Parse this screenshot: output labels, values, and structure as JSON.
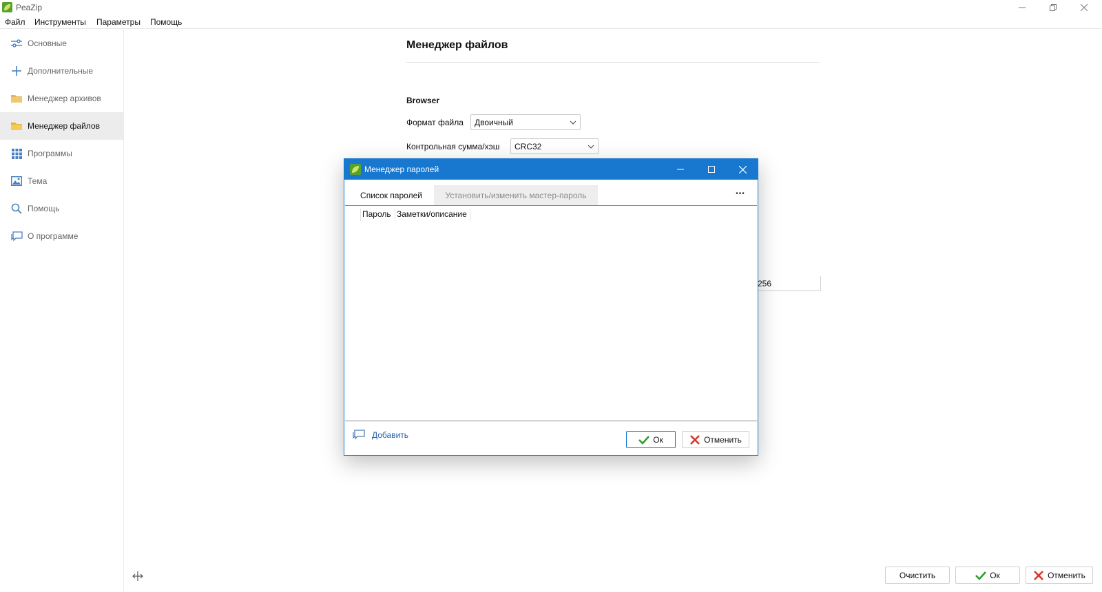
{
  "app": {
    "title": "PeaZip"
  },
  "menu": {
    "items": [
      "Файл",
      "Инструменты",
      "Параметры",
      "Помощь"
    ]
  },
  "sidebar": {
    "items": [
      {
        "label": "Основные",
        "icon": "sliders-icon",
        "active": false
      },
      {
        "label": "Дополнительные",
        "icon": "plus-icon",
        "active": false
      },
      {
        "label": "Менеджер архивов",
        "icon": "archive-folder-icon",
        "active": false
      },
      {
        "label": "Менеджер файлов",
        "icon": "folder-icon",
        "active": true
      },
      {
        "label": "Программы",
        "icon": "grid-icon",
        "active": false
      },
      {
        "label": "Тема",
        "icon": "image-icon",
        "active": false
      },
      {
        "label": "Помощь",
        "icon": "search-icon",
        "active": false
      },
      {
        "label": "О программе",
        "icon": "chat-icon",
        "active": false
      }
    ]
  },
  "main": {
    "title": "Менеджер файлов",
    "group_title": "Browser",
    "fields": [
      {
        "label": "Формат файла",
        "value": "Двоичный"
      },
      {
        "label": "Контрольная сумма/хэш",
        "value": "CRC32"
      }
    ],
    "hidden_input_value": "256"
  },
  "footer": {
    "clear_label": "Очистить",
    "ok_label": "Ок",
    "cancel_label": "Отменить"
  },
  "dialog": {
    "title": "Менеджер паролей",
    "tabs": [
      "Список паролей",
      "Установить/изменить мастер-пароль"
    ],
    "more_label": "•••",
    "columns": [
      "Пароль",
      "Заметки/описание"
    ],
    "add_label": "Добавить",
    "ok_label": "Ок",
    "cancel_label": "Отменить"
  },
  "colors": {
    "accent": "#1878d0",
    "ok_green": "#2e9e2e",
    "cancel_red": "#d9362b",
    "folder_yellow": "#f2c54a"
  }
}
